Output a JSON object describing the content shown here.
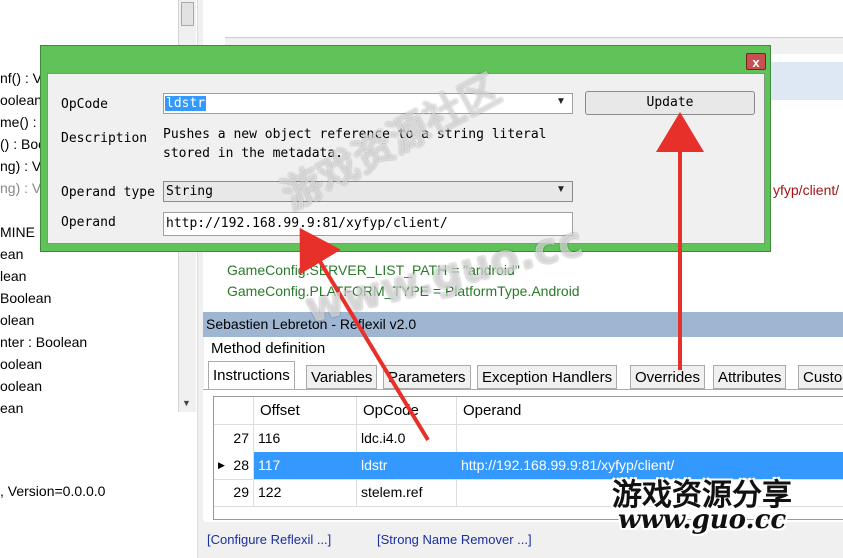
{
  "left_tree": {
    "lines": [
      "nf() : V",
      "oolean",
      "me() : B",
      "() : Boo",
      "ng) : V",
      "ng) : V",
      "MINE :",
      "ean",
      "lean",
      "Boolean",
      "olean",
      "nter : Boolean",
      "oolean",
      "oolean",
      "ean"
    ],
    "version_text": ", Version=0.0.0.0"
  },
  "code": {
    "lines": [
      "GameConfig.SERVER_LIST_PATH = \"android\"",
      "GameConfig.PLATFORM_TYPE = PlatformType.Android"
    ],
    "right_fragment": "yfyp/client/"
  },
  "title_bar": {
    "text": "Sebastien Lebreton - Reflexil v2.0"
  },
  "method_definition": {
    "label": "Method definition"
  },
  "tabs": [
    {
      "label": "Instructions",
      "active": true
    },
    {
      "label": "Variables"
    },
    {
      "label": "Parameters"
    },
    {
      "label": "Exception Handlers"
    },
    {
      "label": "Overrides"
    },
    {
      "label": "Attributes"
    },
    {
      "label": "Custo"
    }
  ],
  "grid": {
    "headers": [
      "Offset",
      "OpCode",
      "Operand"
    ],
    "rows": [
      {
        "index": "27",
        "offset": "116",
        "opcode": "ldc.i4.0",
        "operand": "",
        "selected": false
      },
      {
        "index": "28",
        "offset": "117",
        "opcode": "ldstr",
        "operand": "http://192.168.99.9:81/xyfyp/client/",
        "selected": true
      },
      {
        "index": "29",
        "offset": "122",
        "opcode": "stelem.ref",
        "operand": "",
        "selected": false
      }
    ]
  },
  "bottom_links": {
    "configure": "[Configure Reflexil ...]",
    "strong_name": "[Strong Name Remover ...]"
  },
  "dialog": {
    "close_label": "x",
    "opcode_label": "OpCode",
    "opcode_value": "ldstr",
    "update_label": "Update",
    "description_label": "Description",
    "description_text": "Pushes a new object reference to a string literal\nstored in the metadata.",
    "operand_type_label": "Operand type",
    "operand_type_value": "String",
    "operand_label": "Operand",
    "operand_value": "http://192.168.99.9:81/xyfyp/client/"
  },
  "watermark": {
    "cn_text": "游戏资源分享",
    "url_text": "www.guo.cc",
    "center_cn": "游戏资源社区",
    "center_url": "www.guo.cc"
  },
  "colors": {
    "dialog_green": "#5fc35a",
    "selection_blue": "#3399ff",
    "arrow_red": "#e8302a",
    "title_bar": "#9fb6d3"
  }
}
